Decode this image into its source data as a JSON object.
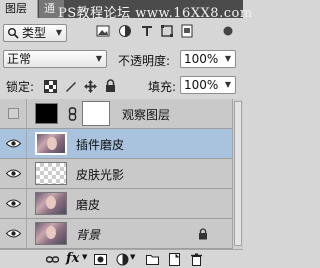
{
  "tabs": {
    "active": "图层",
    "inactive": "通"
  },
  "watermark": "PS教程论坛 www.16XX8.com",
  "filter": {
    "prefix_icon": "search-icon",
    "value": "类型"
  },
  "filter_icons": [
    "image-filter-icon",
    "adjustment-filter-icon",
    "type-filter-icon",
    "shape-filter-icon",
    "smart-object-filter-icon",
    "filter-toggle-icon"
  ],
  "blend": {
    "mode": "正常",
    "opacity_label": "不透明度:",
    "opacity_value": "100%"
  },
  "lock": {
    "label": "锁定:",
    "fill_label": "填充:",
    "fill_value": "100%"
  },
  "layers": [
    {
      "name": "观察图层",
      "visible": false,
      "thumbs": [
        "black-thumbnail",
        "white-mask-thumbnail"
      ],
      "linked": true,
      "selected": false
    },
    {
      "name": "插件磨皮",
      "visible": true,
      "thumbs": [
        "photo-thumbnail"
      ],
      "selected": true
    },
    {
      "name": "皮肤光影",
      "visible": true,
      "thumbs": [
        "transparent-thumbnail"
      ],
      "selected": false
    },
    {
      "name": "磨皮",
      "visible": true,
      "thumbs": [
        "photo-thumbnail"
      ],
      "selected": false
    },
    {
      "name": "背景",
      "visible": true,
      "thumbs": [
        "photo-thumbnail"
      ],
      "selected": false,
      "locked": true,
      "italic": true
    }
  ],
  "bottom_icons": [
    "link-layers-icon",
    "fx-icon",
    "add-mask-icon",
    "adjustment-layer-icon",
    "new-group-icon",
    "new-layer-icon",
    "delete-icon"
  ],
  "fx_label": "fx"
}
